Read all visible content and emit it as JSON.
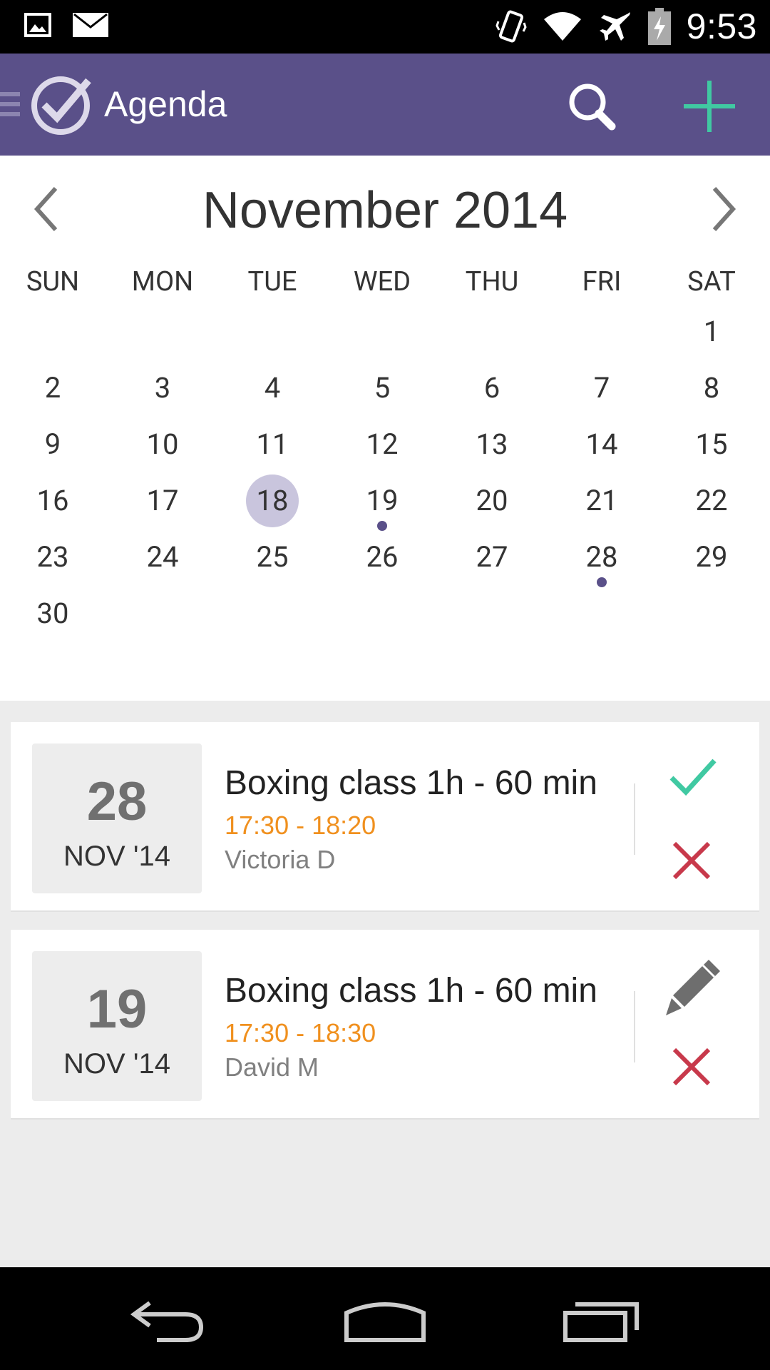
{
  "status_bar": {
    "time": "9:53",
    "icons": [
      "image-notification-icon",
      "mail-notification-icon",
      "vibrate-icon",
      "wifi-icon",
      "airplane-icon",
      "battery-charging-icon"
    ]
  },
  "app_bar": {
    "title": "Agenda",
    "icons": [
      "drawer-icon",
      "checkmark-logo-icon",
      "search-icon",
      "add-icon"
    ],
    "accent_color": "#40c9a2",
    "background_color": "#5a5089"
  },
  "calendar": {
    "month_title": "November 2014",
    "weekdays": [
      "SUN",
      "MON",
      "TUE",
      "WED",
      "THU",
      "FRI",
      "SAT"
    ],
    "weeks": [
      [
        "",
        "",
        "",
        "",
        "",
        "",
        "1"
      ],
      [
        "2",
        "3",
        "4",
        "5",
        "6",
        "7",
        "8"
      ],
      [
        "9",
        "10",
        "11",
        "12",
        "13",
        "14",
        "15"
      ],
      [
        "16",
        "17",
        "18",
        "19",
        "20",
        "21",
        "22"
      ],
      [
        "23",
        "24",
        "25",
        "26",
        "27",
        "28",
        "29"
      ],
      [
        "30",
        "",
        "",
        "",
        "",
        "",
        ""
      ]
    ],
    "selected_day": "18",
    "event_days": [
      "19",
      "28"
    ]
  },
  "agenda": {
    "cards": [
      {
        "day": "28",
        "month": "NOV '14",
        "title": "Boxing class 1h - 60  min",
        "time": "17:30 - 18:20",
        "person": "Victoria D",
        "actions": [
          "check-icon",
          "close-icon"
        ]
      },
      {
        "day": "19",
        "month": "NOV '14",
        "title": "Boxing class 1h - 60  min",
        "time": "17:30 - 18:30",
        "person": "David M",
        "actions": [
          "pencil-icon",
          "close-icon"
        ]
      }
    ]
  },
  "nav_bar": {
    "icons": [
      "back-icon",
      "home-icon",
      "recent-apps-icon"
    ]
  }
}
